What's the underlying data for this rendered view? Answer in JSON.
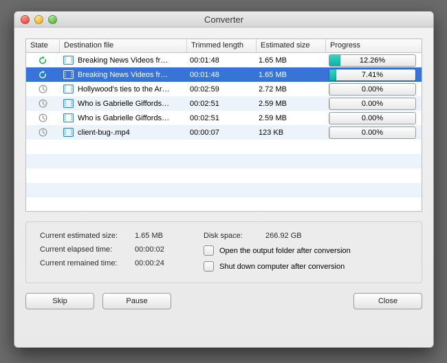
{
  "window": {
    "title": "Converter"
  },
  "columns": {
    "state": "State",
    "file": "Destination file",
    "trimmed": "Trimmed length",
    "est": "Estimated size",
    "progress": "Progress"
  },
  "rows": [
    {
      "state": "active",
      "file": "Breaking News Videos fr…",
      "trimmed": "00:01:48",
      "est": "1.65 MB",
      "progress": 12.26,
      "pct": "12.26%"
    },
    {
      "state": "active",
      "file": "Breaking News Videos fr…",
      "trimmed": "00:01:48",
      "est": "1.65 MB",
      "progress": 7.41,
      "pct": "7.41%",
      "selected": true
    },
    {
      "state": "pending",
      "file": "Hollywood's ties to the Ar…",
      "trimmed": "00:02:59",
      "est": "2.72 MB",
      "progress": 0,
      "pct": "0.00%"
    },
    {
      "state": "pending",
      "file": "Who is Gabrielle Giffords…",
      "trimmed": "00:02:51",
      "est": "2.59 MB",
      "progress": 0,
      "pct": "0.00%"
    },
    {
      "state": "pending",
      "file": "Who is Gabrielle Giffords…",
      "trimmed": "00:02:51",
      "est": "2.59 MB",
      "progress": 0,
      "pct": "0.00%"
    },
    {
      "state": "pending",
      "file": "client-bug-.mp4",
      "trimmed": "00:00:07",
      "est": "123 KB",
      "progress": 0,
      "pct": "0.00%"
    }
  ],
  "info": {
    "est_label": "Current estimated size:",
    "est_value": "1.65 MB",
    "elapsed_label": "Current elapsed time:",
    "elapsed_value": "00:00:02",
    "remain_label": "Current remained time:",
    "remain_value": "00:00:24",
    "disk_label": "Disk space:",
    "disk_value": "266.92 GB",
    "open_label": "Open the output folder after conversion",
    "shutdown_label": "Shut down computer after conversion"
  },
  "buttons": {
    "skip": "Skip",
    "pause": "Pause",
    "close": "Close"
  }
}
